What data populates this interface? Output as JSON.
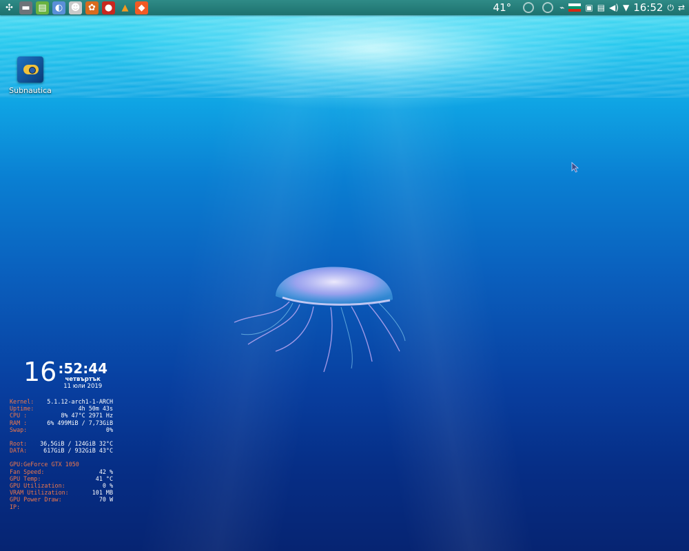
{
  "panel": {
    "launchers": [
      {
        "name": "app-menu-icon",
        "glyph": "✣",
        "bg": "transparent"
      },
      {
        "name": "file-manager-icon",
        "glyph": "▬",
        "bg": "#6d7378"
      },
      {
        "name": "disk-icon",
        "glyph": "▤",
        "bg": "#69b23f"
      },
      {
        "name": "globe-icon",
        "glyph": "◐",
        "bg": "#5a8fd8"
      },
      {
        "name": "penguin-icon",
        "glyph": "☻",
        "bg": "#c9c9c9"
      },
      {
        "name": "game-icon",
        "glyph": "✿",
        "bg": "#d86b1e"
      },
      {
        "name": "red-app-icon",
        "glyph": "●",
        "bg": "#c8271f"
      },
      {
        "name": "vlc-icon",
        "glyph": "▲",
        "bg": "transparent"
      },
      {
        "name": "brave-icon",
        "glyph": "◆",
        "bg": "#f25a24"
      }
    ],
    "temperature": "41°",
    "clock": "16:52"
  },
  "desktop_icon": {
    "label": "Subnautica"
  },
  "conky": {
    "hour": "16",
    "min_sec": ":52:44",
    "weekday": "четвъртък",
    "date": "11 юли 2019",
    "rows1": [
      {
        "k": "Kernel:",
        "v": "5.1.12-arch1-1-ARCH"
      },
      {
        "k": "Uptime:",
        "v": "4h 50m 43s"
      },
      {
        "k": "CPU :",
        "v": "8%  47°C 2971 Hz"
      },
      {
        "k": "RAM :",
        "v": "6% 499MiB / 7,73GiB"
      },
      {
        "k": "Swap:",
        "v": "0%"
      }
    ],
    "rows2": [
      {
        "k": "Root:",
        "v": "36,5GiB / 124GiB  32°C"
      },
      {
        "k": "DATA:",
        "v": "617GiB / 932GiB 43°C"
      }
    ],
    "gpu_title": "GPU:GeForce GTX 1050",
    "rows3": [
      {
        "k": "Fan Speed:",
        "v": "42 %"
      },
      {
        "k": "GPU Temp:",
        "v": "41 °C"
      },
      {
        "k": "GPU Utilization:",
        "v": "0 %"
      },
      {
        "k": "VRAM Utilization:",
        "v": "101 MB"
      },
      {
        "k": "GPU Power Draw:",
        "v": "70 W"
      },
      {
        "k": "IP:",
        "v": ""
      }
    ]
  }
}
